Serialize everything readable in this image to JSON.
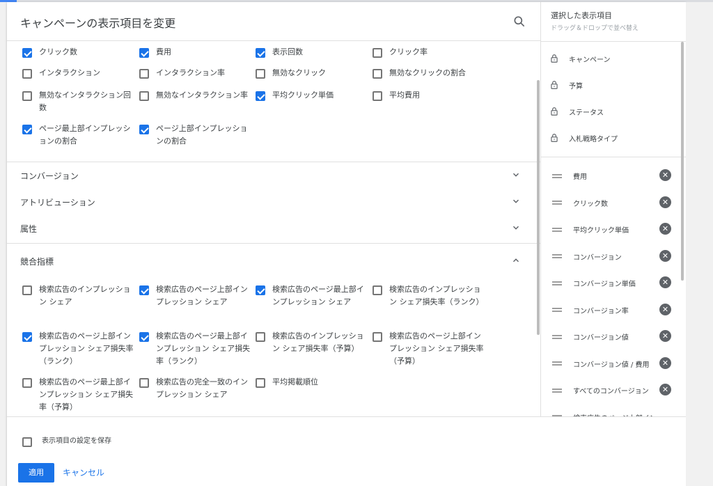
{
  "dialog": {
    "title": "キャンペーンの表示項目を変更",
    "search_icon": "search-icon"
  },
  "performance": [
    {
      "label": "クリック数",
      "checked": true
    },
    {
      "label": "費用",
      "checked": true
    },
    {
      "label": "表示回数",
      "checked": true
    },
    {
      "label": "クリック率",
      "checked": false
    },
    {
      "label": "インタラクション",
      "checked": false
    },
    {
      "label": "インタラクション率",
      "checked": false
    },
    {
      "label": "無効なクリック",
      "checked": false
    },
    {
      "label": "無効なクリックの割合",
      "checked": false
    },
    {
      "label": "無効なインタラクション回数",
      "checked": false
    },
    {
      "label": "無効なインタラクション率",
      "checked": false
    },
    {
      "label": "平均クリック単価",
      "checked": true
    },
    {
      "label": "平均費用",
      "checked": false
    },
    {
      "label": "ページ最上部インプレッションの割合",
      "checked": true
    },
    {
      "label": "ページ上部インプレッションの割合",
      "checked": true
    }
  ],
  "sections": {
    "conversions": "コンバージョン",
    "attribution": "アトリビューション",
    "attributes": "属性",
    "competitive": "競合指標"
  },
  "competitive": [
    {
      "label": "検索広告のインプレッション シェア",
      "checked": false
    },
    {
      "label": "検索広告のページ上部インプレッション シェア",
      "checked": true
    },
    {
      "label": "検索広告のページ最上部インプレッション シェア",
      "checked": true
    },
    {
      "label": "検索広告のインプレッション シェア損失率（ランク）",
      "checked": false
    },
    {
      "label": "検索広告のページ上部インプレッション シェア損失率（ランク）",
      "checked": true
    },
    {
      "label": "検索広告のページ最上部インプレッション シェア損失率（ランク）",
      "checked": true
    },
    {
      "label": "検索広告のインプレッション シェア損失率（予算）",
      "checked": false
    },
    {
      "label": "検索広告のページ上部インプレッション シェア損失率（予算）",
      "checked": false
    },
    {
      "label": "検索広告のページ最上部インプレッション シェア損失率（予算）",
      "checked": false
    },
    {
      "label": "検索広告の完全一致のインプレッション シェア",
      "checked": false
    },
    {
      "label": "平均掲載順位",
      "checked": false
    }
  ],
  "selected_panel": {
    "title": "選択した表示項目",
    "subtitle": "ドラッグ＆ドロップで並べ替え",
    "locked": [
      "キャンペーン",
      "予算",
      "ステータス",
      "入札戦略タイプ"
    ],
    "items": [
      "費用",
      "クリック数",
      "平均クリック単価",
      "コンバージョン",
      "コンバージョン単価",
      "コンバージョン率",
      "コンバージョン値",
      "コンバージョン値 / 費用",
      "すべてのコンバージョン",
      "検索広告のページ上部イン…"
    ]
  },
  "footer": {
    "save_label": "表示項目の設定を保存",
    "save_checked": false,
    "apply_label": "適用",
    "cancel_label": "キャンセル"
  },
  "colors": {
    "accent": "#1a73e8"
  }
}
